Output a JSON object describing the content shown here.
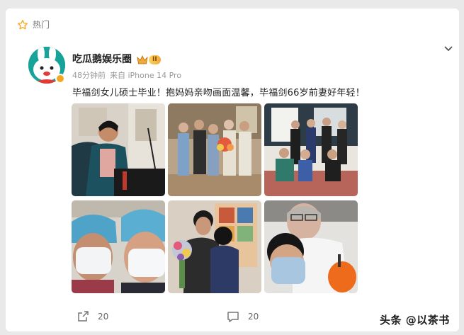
{
  "hot_label": "热门",
  "user": {
    "name": "吃瓜鹅娱乐圈",
    "vip_level": "II"
  },
  "meta": {
    "time": "48分钟前",
    "source": "来自 iPhone 14 Pro"
  },
  "post": {
    "text": "毕福剑女儿硕士毕业！抱妈妈亲吻画面温馨，毕福剑66岁前妻好年轻！"
  },
  "actions": {
    "share_count": "20",
    "comment_count": "20"
  },
  "watermark": "头条 @以茶书",
  "colors": {
    "accent": "#f5a623",
    "avatar": "#18a39a"
  }
}
